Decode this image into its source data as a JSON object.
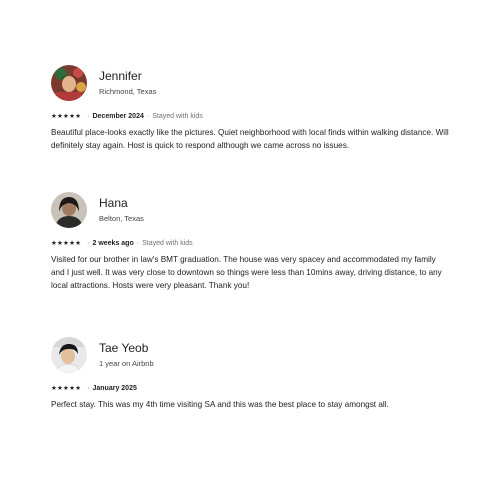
{
  "reviews": [
    {
      "name": "Jennifer",
      "subtitle": "Richmond, Texas",
      "stars": "★★★★★",
      "date": "December 2024",
      "trip": "Stayed with kids",
      "text": "Beautiful place-looks exactly like the pictures. Quiet neighborhood with local finds within walking distance. Will definitely stay again. Host is quick to respond although we came across no issues."
    },
    {
      "name": "Hana",
      "subtitle": "Belton, Texas",
      "stars": "★★★★★",
      "date": "2 weeks ago",
      "trip": "Stayed with kids",
      "text": "Visited for our brother in law's BMT graduation. The house was very spacey and accommodated my family and I just well. It was very close to downtown so things were less than 10mins away, driving distance, to any local attractions. Hosts were very pleasant. Thank you!"
    },
    {
      "name": "Tae Yeob",
      "subtitle": "1 year on Airbnb",
      "stars": "★★★★★",
      "date": "January 2025",
      "trip": "",
      "text": "Perfect stay. This was my 4th time visiting SA and this was the best place to stay amongst all."
    }
  ]
}
